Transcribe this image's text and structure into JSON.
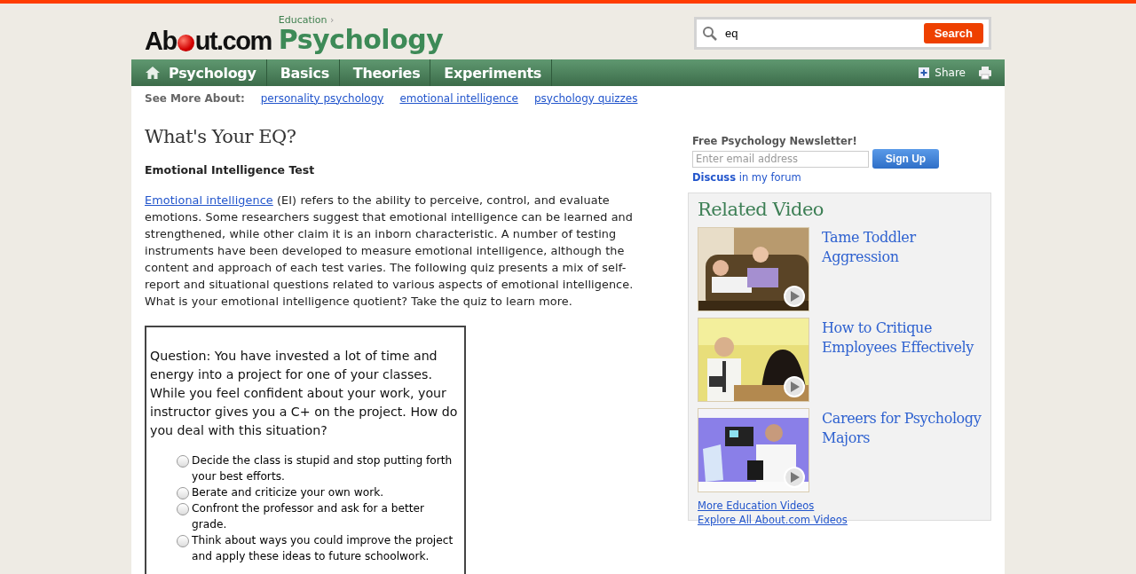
{
  "header": {
    "logo_start": "Ab",
    "logo_end": "ut.com",
    "breadcrumb": "Education",
    "breadcrumb_arrow": "›",
    "site": "Psychology"
  },
  "search": {
    "value": "eq",
    "button": "Search"
  },
  "nav": {
    "tabs": [
      {
        "label": "Psychology",
        "kind": "home"
      },
      {
        "label": "Basics",
        "kind": "plain"
      },
      {
        "label": "Theories",
        "kind": "plain"
      },
      {
        "label": "Experiments",
        "kind": "plain"
      }
    ],
    "share": "Share"
  },
  "see_more": {
    "label": "See More About:",
    "links": [
      "personality psychology",
      "emotional intelligence",
      "psychology quizzes"
    ]
  },
  "article": {
    "title": "What's Your EQ?",
    "subtitle": "Emotional Intelligence Test",
    "intro_link": "Emotional intelligence",
    "intro": " (EI) refers to the ability to perceive, control, and evaluate emotions. Some researchers suggest that emotional intelligence can be learned and strengthened, while other claim it is an inborn characteristic. A number of testing instruments have been developed to measure emotional intelligence, although the content and approach of each test varies. The following quiz presents a mix of self-report and situational questions related to various aspects of emotional intelligence. What is your emotional intelligence quotient? Take the quiz to learn more."
  },
  "quiz": {
    "question": "Question: You have invested a lot of time and energy into a project for one of your classes. While you feel confident about your work, your instructor gives you a C+ on the project. How do you deal with this situation?",
    "options": [
      {
        "label": "Decide the class is stupid and stop putting forth your best efforts.",
        "selected": false
      },
      {
        "label": "Berate and criticize your own work.",
        "selected": false
      },
      {
        "label": "Confront the professor and ask for a better grade.",
        "selected": false
      },
      {
        "label": "Think about ways you could improve the project and apply these ideas to future schoolwork.",
        "selected": false
      }
    ]
  },
  "newsletter": {
    "title": "Free Psychology Newsletter!",
    "placeholder": "Enter email address",
    "button": "Sign Up",
    "discuss": "Discuss",
    "forum": "in my forum"
  },
  "related": {
    "title": "Related Video",
    "videos": [
      {
        "title": "Tame Toddler Aggression",
        "kind": "picture"
      },
      {
        "title": "How to Critique Employees Effectively",
        "kind": "picture"
      },
      {
        "title": "Careers for Psychology Majors",
        "kind": "picture"
      }
    ],
    "links": [
      "More Education Videos",
      "Explore All About.com Videos"
    ]
  }
}
